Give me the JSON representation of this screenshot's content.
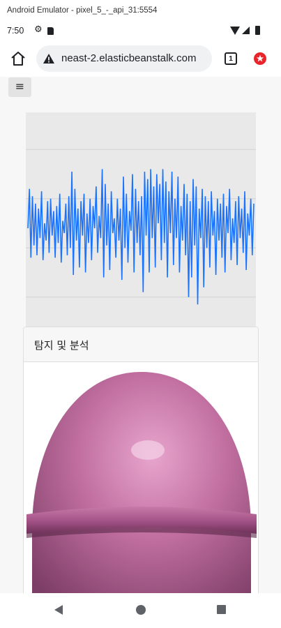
{
  "emulator": {
    "title": "Android Emulator - pixel_5_-_api_31:5554"
  },
  "status_bar": {
    "time": "7:50",
    "icons": [
      "gear-icon",
      "sd-card-icon",
      "wifi-icon",
      "signal-icon",
      "battery-icon"
    ]
  },
  "browser": {
    "url": "neast-2.elasticbeanstalk.com",
    "security": "not-secure-warning-icon",
    "tab_count": "1",
    "accent_color": "#e8242c"
  },
  "page": {
    "menu_glyph": "≡",
    "card_title": "탐지 및 분석"
  },
  "chart_data": {
    "type": "line",
    "color": "#1a73ff",
    "grid": true,
    "ylim": [
      -3,
      5
    ],
    "values": [
      0.8,
      2.4,
      -0.4,
      2.1,
      0.1,
      1.8,
      -0.3,
      1.6,
      0.4,
      2.3,
      -0.5,
      1.0,
      0.3,
      1.9,
      -0.2,
      2.0,
      0.5,
      1.5,
      -0.4,
      1.7,
      0.2,
      2.2,
      -0.6,
      1.1,
      0.6,
      1.8,
      -0.3,
      2.1,
      0.0,
      3.1,
      -1.1,
      2.4,
      0.3,
      1.6,
      -0.8,
      1.9,
      0.5,
      2.2,
      -1.0,
      1.4,
      0.2,
      2.0,
      -0.5,
      1.7,
      0.8,
      2.5,
      -0.2,
      1.3,
      0.4,
      3.2,
      -1.2,
      2.6,
      0.1,
      1.8,
      -0.9,
      2.3,
      0.6,
      1.2,
      -0.4,
      2.0,
      0.3,
      1.6,
      -1.3,
      2.9,
      0.0,
      2.2,
      -0.6,
      1.5,
      0.7,
      3.0,
      -1.0,
      2.4,
      0.2,
      1.9,
      -0.3,
      2.1,
      -1.8,
      3.1,
      0.5,
      2.8,
      -1.0,
      3.2,
      0.4,
      2.5,
      -0.8,
      3.0,
      1.0,
      2.6,
      -0.5,
      3.2,
      0.2,
      2.7,
      -1.2,
      2.3,
      0.6,
      3.1,
      -0.7,
      2.0,
      0.4,
      2.9,
      -1.0,
      1.7,
      0.3,
      2.6,
      -0.3,
      2.2,
      -2.0,
      1.9,
      -1.2,
      2.8,
      0.1,
      2.5,
      -2.3,
      1.6,
      0.4,
      2.4,
      -1.6,
      2.1,
      0.0,
      1.9,
      -0.8,
      2.3,
      0.5,
      1.5,
      -1.1,
      2.0,
      0.3,
      1.8,
      -0.4,
      2.2,
      -1.0,
      1.7,
      0.6,
      2.4,
      -0.5,
      1.2,
      0.2,
      1.9,
      -0.7,
      2.1,
      0.4,
      1.6,
      -0.2,
      2.3,
      -0.9,
      1.4,
      0.5,
      2.0,
      -0.3,
      1.8
    ]
  }
}
